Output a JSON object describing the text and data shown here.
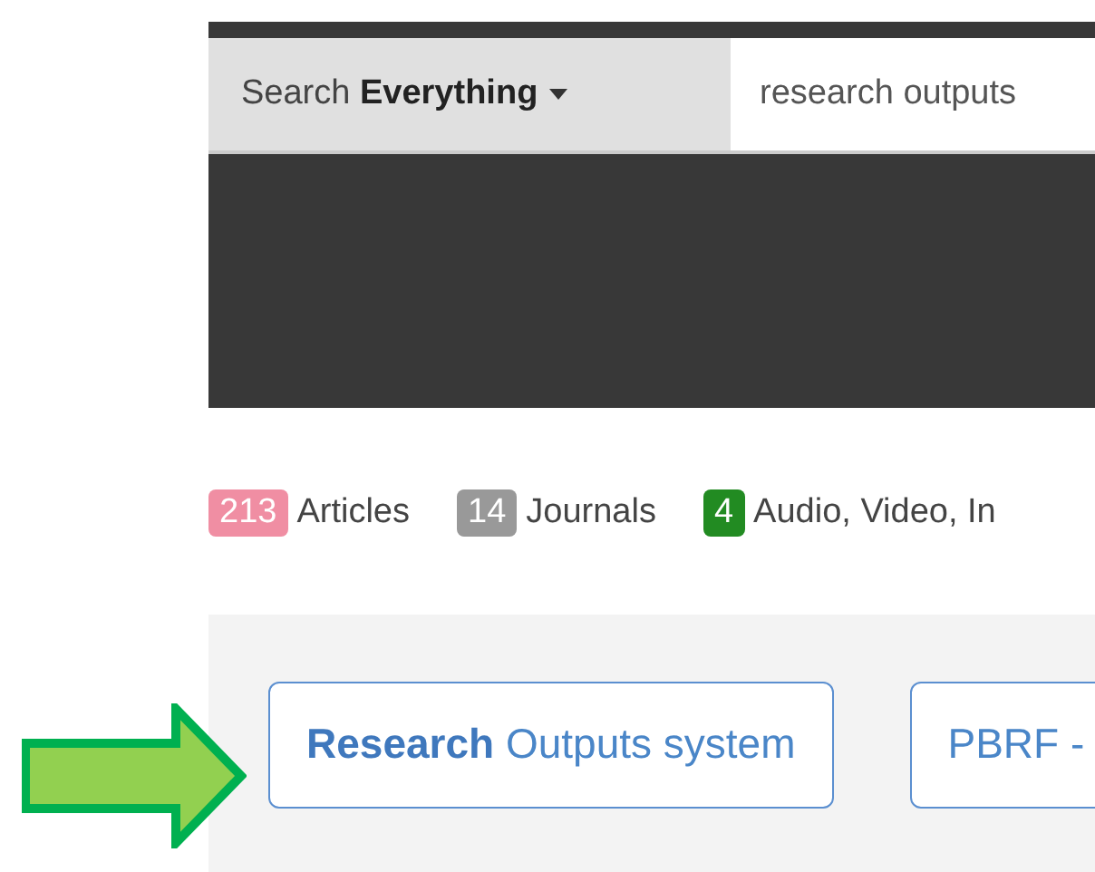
{
  "search": {
    "scope_label": "Search **Everything**",
    "value": "research outputs"
  },
  "counts": [
    {
      "count": "213",
      "label": "Articles",
      "color": "#f08ea3"
    },
    {
      "count": "14",
      "label": "Journals",
      "color": "#999999"
    },
    {
      "count": "4",
      "label": "Audio, Video, In",
      "color": "#228b22"
    }
  ],
  "results": [
    {
      "label": "**Research** Outputs system"
    },
    {
      "label": "PBRF -"
    }
  ]
}
